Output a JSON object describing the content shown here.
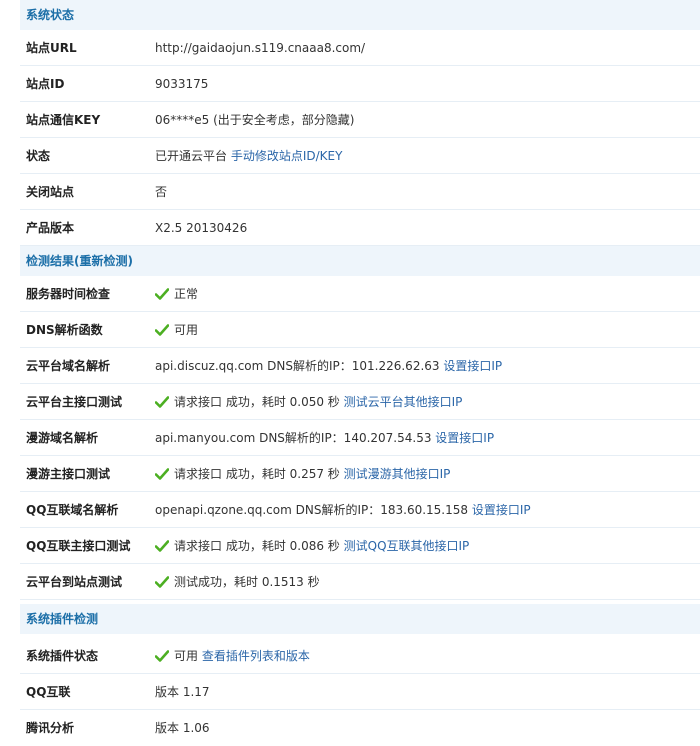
{
  "colors": {
    "section_bg": "#eef5fb",
    "section_text": "#1c6fa8",
    "link": "#2b66a8",
    "check": "#4caf22"
  },
  "system_status": {
    "title": "系统状态",
    "site_url": {
      "label": "站点URL",
      "value": "http://gaidaojun.s119.cnaaa8.com/"
    },
    "site_id": {
      "label": "站点ID",
      "value": "9033175"
    },
    "site_key": {
      "label": "站点通信KEY",
      "value": "06****e5 (出于安全考虑，部分隐藏)"
    },
    "status": {
      "label": "状态",
      "value": "已开通云平台 ",
      "link": "手动修改站点ID/KEY"
    },
    "close_site": {
      "label": "关闭站点",
      "value": "否"
    },
    "version": {
      "label": "产品版本",
      "value": "X2.5 20130426"
    }
  },
  "check_results": {
    "title": "检测结果(重新检测)",
    "server_time": {
      "label": "服务器时间检查",
      "value": "正常"
    },
    "dns_func": {
      "label": "DNS解析函数",
      "value": "可用"
    },
    "cloud_dns": {
      "label": "云平台域名解析",
      "value": "api.discuz.qq.com DNS解析的IP：101.226.62.63 ",
      "link": "设置接口IP"
    },
    "cloud_api": {
      "label": "云平台主接口测试",
      "value": "请求接口 成功，耗时 0.050 秒 ",
      "link": "测试云平台其他接口IP"
    },
    "manyou_dns": {
      "label": "漫游域名解析",
      "value": "api.manyou.com DNS解析的IP：140.207.54.53 ",
      "link": "设置接口IP"
    },
    "manyou_api": {
      "label": "漫游主接口测试",
      "value": "请求接口 成功，耗时 0.257 秒 ",
      "link": "测试漫游其他接口IP"
    },
    "qq_dns": {
      "label": "QQ互联域名解析",
      "value": "openapi.qzone.qq.com DNS解析的IP：183.60.15.158 ",
      "link": "设置接口IP"
    },
    "qq_api": {
      "label": "QQ互联主接口测试",
      "value": "请求接口 成功，耗时 0.086 秒 ",
      "link": "测试QQ互联其他接口IP"
    },
    "cloud_to_site": {
      "label": "云平台到站点测试",
      "value": "测试成功，耗时 0.1513 秒"
    }
  },
  "plugin_check": {
    "title": "系统插件检测",
    "plugin_status": {
      "label": "系统插件状态",
      "value": "可用 ",
      "link": "查看插件列表和版本"
    },
    "qq_connect": {
      "label": "QQ互联",
      "value": "版本 1.17"
    },
    "tencent_analytics": {
      "label": "腾讯分析",
      "value": "版本 1.06"
    }
  }
}
